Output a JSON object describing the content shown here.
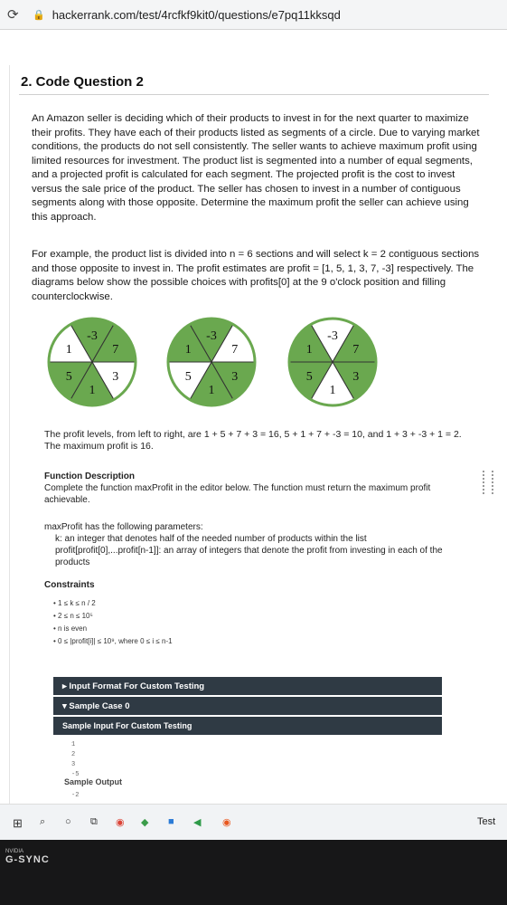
{
  "browser": {
    "url": "hackerrank.com/test/4rcfkf9kit0/questions/e7pq11kksqd"
  },
  "question": {
    "title": "2. Code Question 2",
    "intro": "An Amazon seller is deciding which of their products to invest in for the next quarter to maximize their profits. They have each of their products listed as segments of a circle. Due to varying market conditions, the products do not sell consistently. The seller wants to achieve maximum profit using limited resources for investment. The product list is segmented into a number of equal segments, and a projected profit is calculated for each segment. The projected profit is the cost to invest versus the sale price of the product. The seller has chosen to invest in a number of contiguous segments along with those opposite. Determine the maximum profit the seller can achieve using this approach.",
    "example": "For example, the product list is divided into n = 6 sections and will select k = 2 contiguous sections and those opposite to invest in. The profit estimates are profit = [1, 5, 1, 3, 7, -3] respectively. The diagrams below show the possible choices with profits[0] at the 9 o'clock position and filling counterclockwise.",
    "wheel_labels": [
      "-3",
      "7",
      "3",
      "1",
      "5",
      "1"
    ],
    "wheels": [
      {
        "highlighted": [
          0,
          1,
          3,
          4
        ]
      },
      {
        "highlighted": [
          5,
          0,
          2,
          3
        ]
      },
      {
        "highlighted": [
          4,
          5,
          1,
          2
        ]
      }
    ],
    "profit_levels": "The profit levels, from left to right, are 1 + 5 + 7 + 3 = 16, 5 + 1 + 7 + -3 = 10, and 1 + 3 + -3 + 1 = 2. The maximum profit is 16.",
    "function_heading": "Function Description",
    "function_desc": "Complete the function maxProfit in the editor below. The function must return the maximum profit achievable.",
    "params_intro": "maxProfit has the following parameters:",
    "param_k": "k: an integer that denotes half of the needed number of products within the list",
    "param_profit": "profit[profit[0],...profit[n-1]]: an array of integers that denote the profit from investing in each of the products",
    "constraints_heading": "Constraints",
    "constraints": [
      "1 ≤ k ≤ n / 2",
      "2 ≤ n ≤ 10⁵",
      "n is even",
      "0 ≤ |profit[i]| ≤ 10⁹, where 0 ≤ i ≤ n-1"
    ],
    "input_format_label": "▸ Input Format For Custom Testing",
    "sample_case_label": "▾ Sample Case 0",
    "sample_input_label": "Sample Input For Custom Testing",
    "sample_input_lines": [
      "1",
      "2",
      "3",
      "-5"
    ],
    "sample_output_label": "Sample Output",
    "sample_output_value": "-2"
  },
  "taskbar": {
    "test_label": "Test"
  },
  "monitor": {
    "brand": "NVIDIA",
    "gsync": "G-SYNC"
  },
  "colors": {
    "green": "#6aa84f",
    "bar": "#2f3a44"
  }
}
